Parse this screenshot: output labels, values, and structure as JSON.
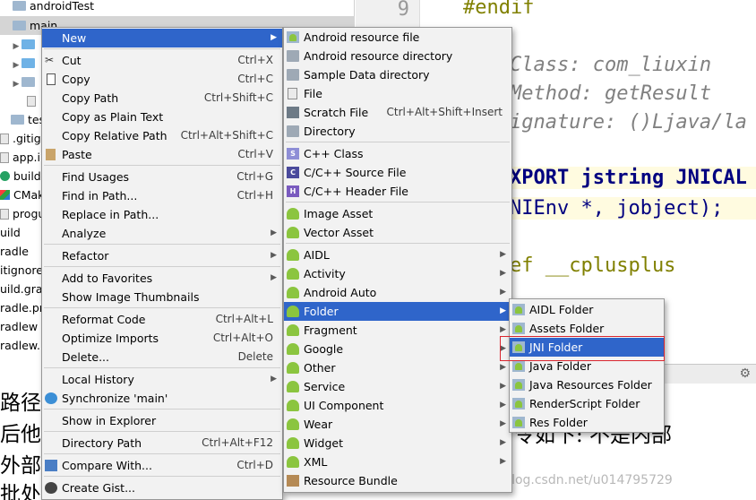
{
  "tree": {
    "rows": [
      {
        "label": "androidTest",
        "kind": "folder"
      },
      {
        "label": "main",
        "kind": "folder"
      },
      {
        "label": "",
        "kind": "folder-blue"
      },
      {
        "label": "",
        "kind": "folder-blue"
      },
      {
        "label": "",
        "kind": "folder"
      },
      {
        "label": "",
        "kind": "file"
      },
      {
        "label": "tes",
        "kind": "folder"
      },
      {
        "label": ".gitign",
        "kind": "file"
      },
      {
        "label": "app.in",
        "kind": "file"
      },
      {
        "label": "build.g",
        "kind": "gradle"
      },
      {
        "label": "CMak",
        "kind": "cmake"
      },
      {
        "label": "progu",
        "kind": "file"
      },
      {
        "label": "uild",
        "kind": "none"
      },
      {
        "label": "radle",
        "kind": "none"
      },
      {
        "label": "itignore",
        "kind": "none"
      },
      {
        "label": "uild.grad",
        "kind": "none"
      },
      {
        "label": "radle.pr",
        "kind": "none"
      },
      {
        "label": "radlew",
        "kind": "none"
      },
      {
        "label": "radlew.b",
        "kind": "none"
      }
    ]
  },
  "editor": {
    "line_number": "9",
    "lines": [
      {
        "text": "#endif",
        "style": "kw"
      },
      {
        "text": "Class:    com_liuxin",
        "style": "cmt"
      },
      {
        "text": "Method:   getResult",
        "style": "cmt"
      },
      {
        "text": "ignature: ()Ljava/la",
        "style": "cmt"
      },
      {
        "text": "XPORT jstring JNICAL",
        "style": "decl"
      },
      {
        "text": "NIEnv *, jobject);",
        "style": "plain"
      },
      {
        "text": "ef __cplusplus",
        "style": "kw"
      }
    ]
  },
  "doc": {
    "line1": "路径",
    "line2": "后他",
    "line3": "外部",
    "line4": "批处",
    "right_text": "令如下:   不是内部"
  },
  "watermark": "https://blog.csdn.net/u014795729",
  "context_menu": {
    "items": [
      {
        "label": "New",
        "shortcut": "",
        "sub": true,
        "selected": true
      },
      {
        "label": "Cut",
        "shortcut": "Ctrl+X",
        "icon": "cut-icon"
      },
      {
        "label": "Copy",
        "shortcut": "Ctrl+C",
        "icon": "copy-icon"
      },
      {
        "label": "Copy Path",
        "shortcut": "Ctrl+Shift+C"
      },
      {
        "label": "Copy as Plain Text",
        "shortcut": ""
      },
      {
        "label": "Copy Relative Path",
        "shortcut": "Ctrl+Alt+Shift+C"
      },
      {
        "label": "Paste",
        "shortcut": "Ctrl+V",
        "icon": "paste-icon"
      },
      {
        "label": "Find Usages",
        "shortcut": "Ctrl+G"
      },
      {
        "label": "Find in Path...",
        "shortcut": "Ctrl+H"
      },
      {
        "label": "Replace in Path...",
        "shortcut": ""
      },
      {
        "label": "Analyze",
        "shortcut": "",
        "sub": true
      },
      {
        "label": "Refactor",
        "shortcut": "",
        "sub": true
      },
      {
        "label": "Add to Favorites",
        "shortcut": "",
        "sub": true
      },
      {
        "label": "Show Image Thumbnails",
        "shortcut": ""
      },
      {
        "label": "Reformat Code",
        "shortcut": "Ctrl+Alt+L"
      },
      {
        "label": "Optimize Imports",
        "shortcut": "Ctrl+Alt+O"
      },
      {
        "label": "Delete...",
        "shortcut": "Delete"
      },
      {
        "label": "Local History",
        "shortcut": "",
        "sub": true
      },
      {
        "label": "Synchronize 'main'",
        "shortcut": "",
        "icon": "sync-icon"
      },
      {
        "label": "Show in Explorer",
        "shortcut": ""
      },
      {
        "label": "Directory Path",
        "shortcut": "Ctrl+Alt+F12"
      },
      {
        "label": "Compare With...",
        "shortcut": "Ctrl+D",
        "icon": "compare-icon"
      },
      {
        "label": "Create Gist...",
        "shortcut": "",
        "icon": "gist-icon"
      }
    ]
  },
  "new_menu": {
    "items": [
      {
        "label": "Android resource file"
      },
      {
        "label": "Android resource directory"
      },
      {
        "label": "Sample Data directory"
      },
      {
        "label": "File"
      },
      {
        "label": "Scratch File",
        "shortcut": "Ctrl+Alt+Shift+Insert"
      },
      {
        "label": "Directory"
      },
      {
        "label": "C++ Class"
      },
      {
        "label": "C/C++ Source File"
      },
      {
        "label": "C/C++ Header File"
      },
      {
        "label": "Image Asset"
      },
      {
        "label": "Vector Asset"
      },
      {
        "label": "AIDL",
        "sub": true
      },
      {
        "label": "Activity",
        "sub": true
      },
      {
        "label": "Android Auto",
        "sub": true
      },
      {
        "label": "Folder",
        "sub": true,
        "selected": true
      },
      {
        "label": "Fragment",
        "sub": true
      },
      {
        "label": "Google",
        "sub": true
      },
      {
        "label": "Other",
        "sub": true
      },
      {
        "label": "Service",
        "sub": true
      },
      {
        "label": "UI Component",
        "sub": true
      },
      {
        "label": "Wear",
        "sub": true
      },
      {
        "label": "Widget",
        "sub": true
      },
      {
        "label": "XML",
        "sub": true
      },
      {
        "label": "Resource Bundle"
      }
    ]
  },
  "folder_menu": {
    "items": [
      {
        "label": "AIDL Folder"
      },
      {
        "label": "Assets Folder"
      },
      {
        "label": "JNI Folder",
        "selected": true
      },
      {
        "label": "Java Folder"
      },
      {
        "label": "Java Resources Folder"
      },
      {
        "label": "RenderScript Folder"
      },
      {
        "label": "Res Folder"
      }
    ]
  },
  "colors": {
    "selection": "#2f65ca",
    "menu_bg": "#f2f2f2",
    "highlight_box": "#d9262f"
  }
}
